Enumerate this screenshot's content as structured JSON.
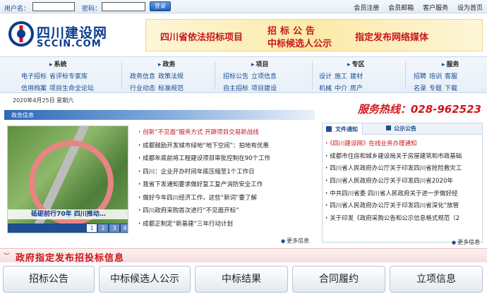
{
  "topbar": {
    "username_label": "用户名：",
    "password_label": "密码：",
    "login_button": "登录",
    "links": [
      "会员注册",
      "会员邮箱",
      "客户服务",
      "设为首页"
    ]
  },
  "header": {
    "logo_cn": "四川建设网",
    "logo_en": "SCCIN.COM",
    "banner_left": "四川省依法招标项目",
    "banner_mid_top": "招标公告",
    "banner_mid_bottom": "中标候选人公示",
    "banner_right": "指定发布网络媒体"
  },
  "categories": [
    {
      "title": "系统",
      "row1": [
        "电子招标",
        "省评标专家库"
      ],
      "row2": [
        "信用档案",
        "项目生命全论坛"
      ]
    },
    {
      "title": "政务",
      "row1": [
        "政务信息",
        "政策法规"
      ],
      "row2": [
        "行业动态",
        "标准规范"
      ]
    },
    {
      "title": "项目",
      "row1": [
        "招标公告",
        "立项信息"
      ],
      "row2": [
        "自主招标",
        "项目建设"
      ]
    },
    {
      "title": "专区",
      "row1": [
        "设计",
        "施工",
        "建材"
      ],
      "row2": [
        "机械",
        "中介",
        "房产"
      ]
    },
    {
      "title": "服务",
      "row1": [
        "招聘",
        "培训",
        "客服"
      ],
      "row2": [
        "名录",
        "专题",
        "下载"
      ]
    }
  ],
  "date": "2020年4月25日 星期六",
  "hotline": "服务热线：028-962523",
  "section_title": "政务信息",
  "slider": {
    "caption": "砥砺前行70年  四川推动…",
    "pages": [
      "1",
      "2",
      "3",
      "4"
    ],
    "active_page": "1"
  },
  "news": [
    "创新“不见面”服务方式  开辟项目交易新战线",
    "成都鼓励开发城市绿地“地下空间”：拍地有优惠",
    "成都年底前将工程建设项目审批控制在90个工作",
    "四川：企业开办时间年底压缩至1个工作日",
    "我省下发通知要求做好复工复产消防安全工作",
    "做好今年四川经济工作，这些“新词”要了解",
    "四川政府采购首次进行“不见面开标”",
    "成都正制定“新基建”三年行动计划"
  ],
  "more_label": "更多信息",
  "right_panel": {
    "tab_active": "文件通知",
    "tab_other": "公示公告",
    "items": [
      "《四川建设网》在线业务办理通知",
      "成都市住房和城乡建设局关于房屋建筑和市政基础",
      "四川省人民政府办公厅关于印发四川省抢险救灾工",
      "四川省人民政府办公厅关于印发四川省2020年",
      "中共四川省委  四川省人民政府关于进一步做好经",
      "四川省人民政府办公厅关于印发四川省深化“放管",
      "关于印发《政府采购公告和公示信息格式规范（2"
    ]
  },
  "bottom": {
    "title": "政府指定发布招投标信息",
    "buttons": [
      "招标公告",
      "中标候选人公示",
      "中标结果",
      "合同履约",
      "立项信息"
    ]
  },
  "colors": {
    "brand_blue": "#0b3c8c",
    "accent_red": "#c8161d"
  }
}
